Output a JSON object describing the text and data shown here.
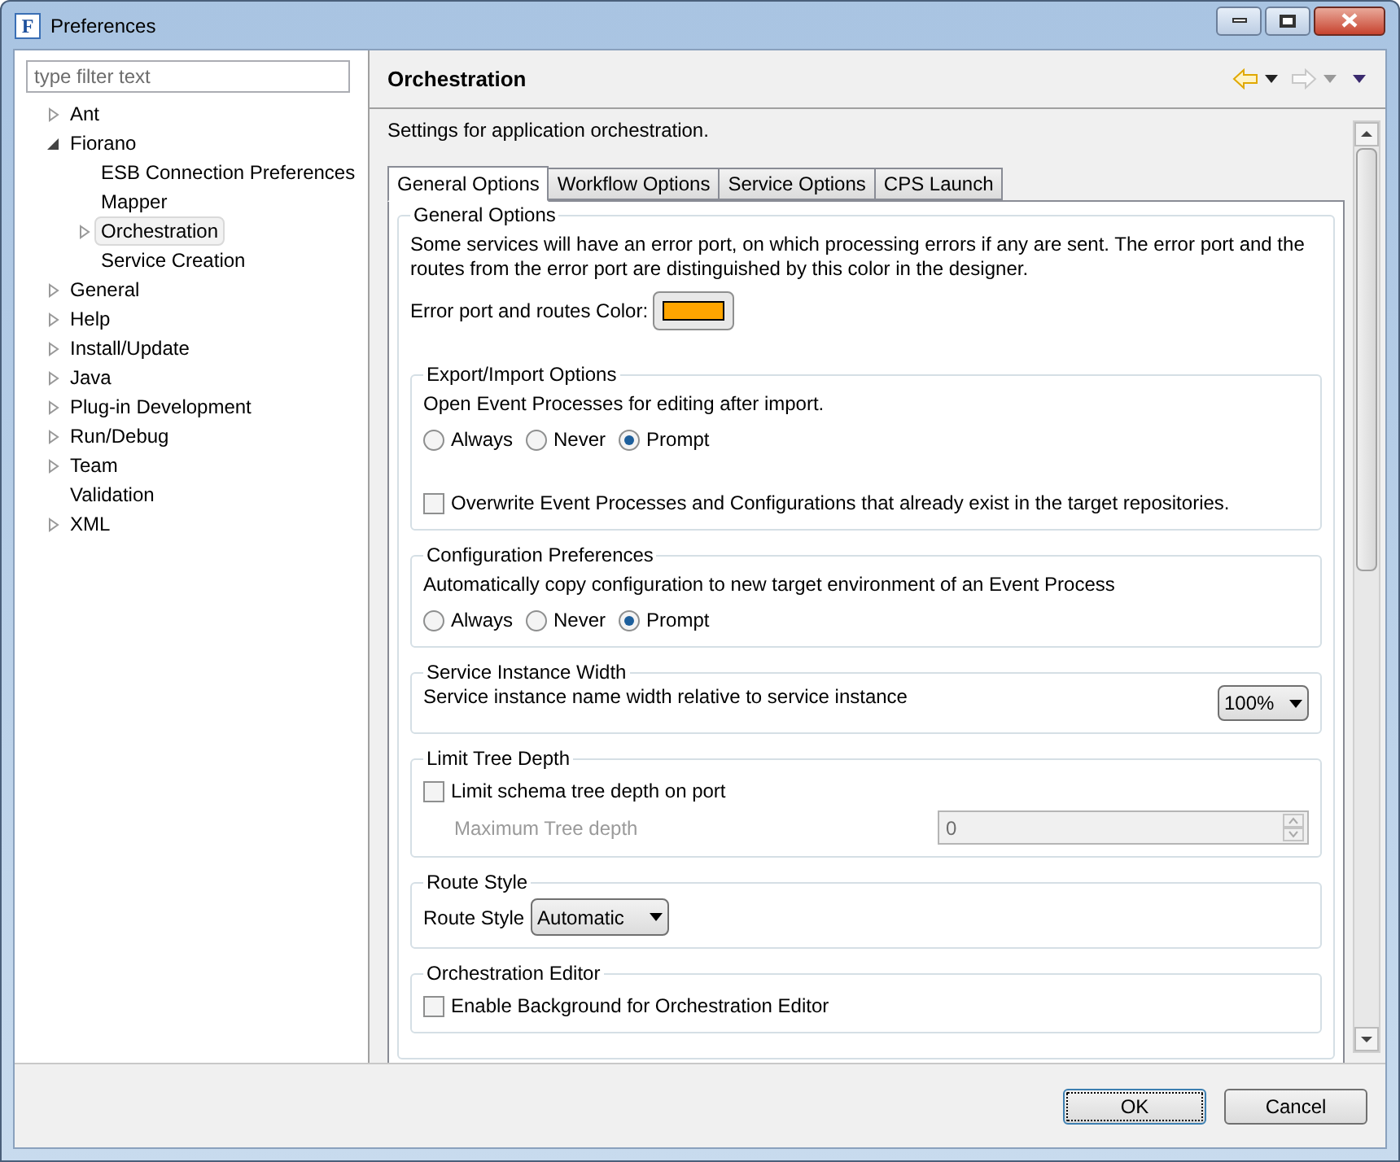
{
  "window": {
    "title": "Preferences",
    "logo_letter": "F"
  },
  "filter": {
    "placeholder": "type filter text"
  },
  "tree": [
    {
      "label": "Ant",
      "expandable": true,
      "expanded": false,
      "selected": false
    },
    {
      "label": "Fiorano",
      "expandable": true,
      "expanded": true,
      "selected": false,
      "children": [
        {
          "label": "ESB Connection Preferences",
          "expandable": false,
          "selected": false
        },
        {
          "label": "Mapper",
          "expandable": false,
          "selected": false
        },
        {
          "label": "Orchestration",
          "expandable": true,
          "expanded": false,
          "selected": true
        },
        {
          "label": "Service Creation",
          "expandable": false,
          "selected": false
        }
      ]
    },
    {
      "label": "General",
      "expandable": true,
      "expanded": false,
      "selected": false
    },
    {
      "label": "Help",
      "expandable": true,
      "expanded": false,
      "selected": false
    },
    {
      "label": "Install/Update",
      "expandable": true,
      "expanded": false,
      "selected": false
    },
    {
      "label": "Java",
      "expandable": true,
      "expanded": false,
      "selected": false
    },
    {
      "label": "Plug-in Development",
      "expandable": true,
      "expanded": false,
      "selected": false
    },
    {
      "label": "Run/Debug",
      "expandable": true,
      "expanded": false,
      "selected": false
    },
    {
      "label": "Team",
      "expandable": true,
      "expanded": false,
      "selected": false
    },
    {
      "label": "Validation",
      "expandable": false,
      "selected": false
    },
    {
      "label": "XML",
      "expandable": true,
      "expanded": false,
      "selected": false
    }
  ],
  "page": {
    "title": "Orchestration",
    "description": "Settings for application orchestration.",
    "back_enabled": true,
    "forward_enabled": false
  },
  "tabs": [
    {
      "label": "General Options",
      "selected": true
    },
    {
      "label": "Workflow Options",
      "selected": false
    },
    {
      "label": "Service Options",
      "selected": false
    },
    {
      "label": "CPS Launch",
      "selected": false
    }
  ],
  "group": {
    "title": "General Options",
    "items": [
      {
        "kind": "text",
        "text": "Some services will have an error port, on which processing errors if any are sent. The error port and the routes from the error port are distinguished by this color in the designer."
      },
      {
        "kind": "color",
        "label": "Error port and routes Color:",
        "color": "#ffa500"
      }
    ],
    "groups": [
      {
        "title": "Export/Import Options",
        "items": [
          {
            "kind": "text",
            "text": "Open Event Processes for editing after import."
          },
          {
            "kind": "radios",
            "options": [
              {
                "label": "Always",
                "selected": false
              },
              {
                "label": "Never",
                "selected": false
              },
              {
                "label": "Prompt",
                "selected": true
              }
            ]
          },
          {
            "kind": "checkbox",
            "label": "Overwrite Event Processes and Configurations that already exist in the target repositories.",
            "checked": false
          }
        ]
      },
      {
        "title": "Configuration Preferences",
        "items": [
          {
            "kind": "text",
            "text": "Automatically copy configuration to new target environment of an Event Process"
          },
          {
            "kind": "radios",
            "options": [
              {
                "label": "Always",
                "selected": false
              },
              {
                "label": "Never",
                "selected": false
              },
              {
                "label": "Prompt",
                "selected": true
              }
            ]
          }
        ]
      },
      {
        "title": "Service Instance Width",
        "items": [
          {
            "kind": "select_row",
            "label": "Service instance name width relative to service instance",
            "value": "100%"
          }
        ]
      },
      {
        "title": "Limit Tree Depth",
        "items": [
          {
            "kind": "checkbox",
            "label": "Limit schema tree depth on port",
            "checked": false
          },
          {
            "kind": "spinner",
            "label": "Maximum Tree depth",
            "value": "0",
            "disabled": true
          }
        ]
      },
      {
        "title": "Route Style",
        "items": [
          {
            "kind": "select_inline",
            "label": "Route Style",
            "value": "Automatic"
          }
        ]
      },
      {
        "title": "Orchestration Editor",
        "items": [
          {
            "kind": "checkbox",
            "label": "Enable Background for Orchestration Editor",
            "checked": false
          }
        ]
      }
    ]
  },
  "buttons": [
    {
      "label": "OK",
      "default": true
    },
    {
      "label": "Cancel",
      "default": false
    }
  ]
}
